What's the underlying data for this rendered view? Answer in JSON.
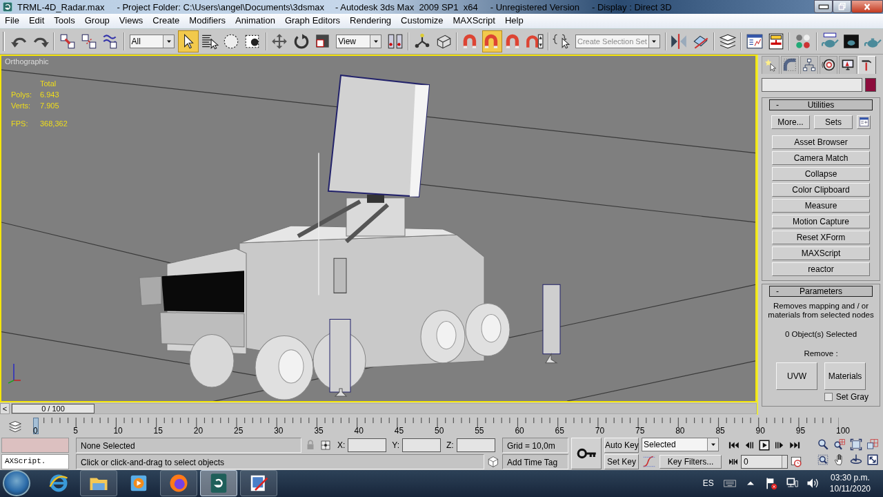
{
  "window": {
    "title_parts": [
      "TRML-4D_Radar.max",
      "- Project Folder: C:\\Users\\angel\\Documents\\3dsmax",
      "- Autodesk 3ds Max  2009 SP1  x64",
      "- Unregistered Version",
      "- Display : Direct 3D"
    ]
  },
  "menu": [
    "File",
    "Edit",
    "Tools",
    "Group",
    "Views",
    "Create",
    "Modifiers",
    "Animation",
    "Graph Editors",
    "Rendering",
    "Customize",
    "MAXScript",
    "Help"
  ],
  "main_toolbar": {
    "selection_filter": "All",
    "reference_coordinate_system": "View",
    "named_selection_set": "Create Selection Set",
    "select_object_on": true,
    "angle_snap_on": true
  },
  "viewport": {
    "label": "Orthographic",
    "active": true,
    "stats_heading": "Total",
    "stats": [
      {
        "label": "Polys:",
        "value": "6.943"
      },
      {
        "label": "Verts:",
        "value": "7.905"
      }
    ],
    "fps": {
      "label": "FPS:",
      "value": "368,362"
    }
  },
  "command_panel": {
    "tabs": [
      {
        "selected": false
      },
      {
        "selected": false
      },
      {
        "selected": false
      },
      {
        "selected": false
      },
      {
        "selected": false
      },
      {
        "selected": true
      }
    ],
    "utilities": {
      "collapse_sign": "-",
      "title": "Utilities",
      "more_button": "More...",
      "sets_button": "Sets",
      "buttons": [
        "Asset Browser",
        "Camera Match",
        "Collapse",
        "Color Clipboard",
        "Measure",
        "Motion Capture",
        "Reset XForm",
        "MAXScript",
        "reactor"
      ]
    },
    "parameters": {
      "collapse_sign": "-",
      "title": "Parameters",
      "description": "Removes mapping and / or materials from selected nodes",
      "selection_count": "0 Object(s) Selected",
      "remove_label": "Remove :",
      "buttons": [
        "UVW",
        "Materials"
      ],
      "set_gray": {
        "label": "Set Gray",
        "checked": false
      }
    }
  },
  "time_slider": {
    "label": "0 / 100",
    "prev": "<",
    "level": 0
  },
  "track_bar": {
    "frame_labels": [
      "0",
      "5",
      "10",
      "15",
      "20",
      "25",
      "30",
      "35",
      "40",
      "45",
      "50",
      "55",
      "60",
      "65",
      "70",
      "75",
      "80",
      "85",
      "90",
      "95",
      "100"
    ]
  },
  "status": {
    "listener_input": "AXScript.",
    "selection": "None Selected",
    "coords": [
      {
        "label": "X:"
      },
      {
        "label": "Y:"
      },
      {
        "label": "Z:"
      }
    ],
    "grid": "Grid = 10,0m",
    "prompt": "Click or click-and-drag to select objects",
    "time_tag": "Add Time Tag",
    "auto_key": "Auto Key",
    "set_key": "Set Key",
    "key_set": "Selected",
    "key_filters": "Key Filters...",
    "current_frame": "0"
  },
  "taskbar": {
    "apps": [
      {
        "running": false,
        "selected": false
      },
      {
        "running": true,
        "selected": false
      },
      {
        "running": false,
        "selected": false
      },
      {
        "running": true,
        "selected": false
      },
      {
        "running": true,
        "selected": true
      },
      {
        "running": true,
        "selected": false
      }
    ],
    "language": "ES",
    "time": "03:30 p.m.",
    "date": "10/11/2020"
  }
}
